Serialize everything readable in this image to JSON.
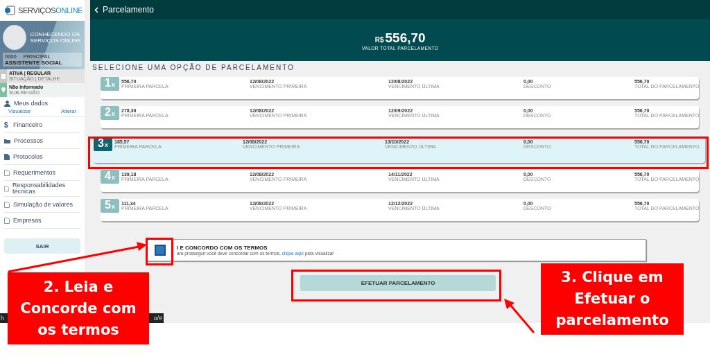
{
  "sidebar": {
    "logo": {
      "part_1": "SERVIÇOS",
      "part_2": "ONLINE"
    },
    "profile": {
      "name": "CONHECENDO OS SERVIÇOS ONLINE",
      "code": "0000",
      "type": "PRINCIPAL",
      "role": "ASSISTENTE SOCIAL"
    },
    "status_rows": [
      {
        "kind": "situation",
        "value": "ATIVA | REGULAR",
        "label": "SITUAÇÃO | DETALHE"
      },
      {
        "kind": "location",
        "value": "Não informado",
        "label": "SUB-REGIÃO"
      }
    ],
    "my_data": {
      "label": "Meus dados",
      "links": [
        "Visualizar",
        "Alterar"
      ]
    },
    "menu": [
      {
        "kind": "dollar",
        "icon_char": "$",
        "label": "Financeiro"
      },
      {
        "kind": "folder",
        "label": "Processos"
      },
      {
        "kind": "file",
        "label": "Protocolos"
      },
      {
        "kind": "page",
        "label": "Requerimentos"
      },
      {
        "kind": "page",
        "label": "Responsabilidades técnicas"
      },
      {
        "kind": "page",
        "label": "Simulação de valores"
      },
      {
        "kind": "page",
        "label": "Empresas"
      }
    ],
    "logout": "SAIR"
  },
  "header": {
    "title": "Parcelamento"
  },
  "total": {
    "currency": "R$",
    "amount": "556,70",
    "label": "VALOR TOTAL PARCELAMENTO"
  },
  "section_title": "SELECIONE UMA OPÇÃO DE PARCELAMENTO",
  "options": [
    {
      "number": "1",
      "suffix": "x",
      "selected": false,
      "fields": [
        {
          "value": "556,70",
          "label": "PRIMEIRA PARCELA"
        },
        {
          "value": "12/08/2022",
          "label": "VENCIMENTO PRIMEIRA"
        },
        {
          "value": "12/08/2022",
          "label": "VENCIMENTO ÚLTIMA"
        },
        {
          "value": "0,00",
          "label": "DESCONTO"
        },
        {
          "value": "556,70",
          "label": "TOTAL DO PARCELAMENTO"
        }
      ]
    },
    {
      "number": "2",
      "suffix": "x",
      "selected": false,
      "fields": [
        {
          "value": "278,36",
          "label": "PRIMEIRA PARCELA"
        },
        {
          "value": "12/08/2022",
          "label": "VENCIMENTO PRIMEIRA"
        },
        {
          "value": "12/09/2022",
          "label": "VENCIMENTO ÚLTIMA"
        },
        {
          "value": "0,00",
          "label": "DESCONTO"
        },
        {
          "value": "556,70",
          "label": "TOTAL DO PARCELAMENTO"
        }
      ]
    },
    {
      "number": "3",
      "suffix": "x",
      "selected": true,
      "fields": [
        {
          "value": "185,57",
          "label": "PRIMEIRA PARCELA"
        },
        {
          "value": "12/08/2022",
          "label": "VENCIMENTO PRIMEIRA"
        },
        {
          "value": "13/10/2022",
          "label": "VENCIMENTO ÚLTIMA"
        },
        {
          "value": "0,00",
          "label": "DESCONTO"
        },
        {
          "value": "556,70",
          "label": "TOTAL DO PARCELAMENTO"
        }
      ]
    },
    {
      "number": "4",
      "suffix": "x",
      "selected": false,
      "fields": [
        {
          "value": "139,18",
          "label": "PRIMEIRA PARCELA"
        },
        {
          "value": "12/08/2022",
          "label": "VENCIMENTO PRIMEIRA"
        },
        {
          "value": "14/11/2022",
          "label": "VENCIMENTO ÚLTIMA"
        },
        {
          "value": "0,00",
          "label": "DESCONTO"
        },
        {
          "value": "556,70",
          "label": "TOTAL DO PARCELAMENTO"
        }
      ]
    },
    {
      "number": "5",
      "suffix": "x",
      "selected": false,
      "fields": [
        {
          "value": "111,34",
          "label": "PRIMEIRA PARCELA"
        },
        {
          "value": "12/08/2022",
          "label": "VENCIMENTO PRIMEIRA"
        },
        {
          "value": "12/12/2022",
          "label": "VENCIMENTO ÚLTIMA"
        },
        {
          "value": "0,00",
          "label": "DESCONTO"
        },
        {
          "value": "556,70",
          "label": "TOTAL DO PARCELAMENTO"
        }
      ]
    }
  ],
  "terms": {
    "checked": false,
    "title": "I E CONCORDO COM OS TERMOS",
    "text_before": "ara prosseguir você deve concordar com os termos, ",
    "link": "clique aqui",
    "text_after": " para visualizar"
  },
  "submit_button": "EFETUAR PARCELAMENTO",
  "status_bar": {
    "url_start": "h",
    "url_end": "o/#"
  },
  "annotations": [
    {
      "text": "2. Leia e Concorde com os termos"
    },
    {
      "text": "3. Clique em Efetuar o parcelamento"
    }
  ]
}
